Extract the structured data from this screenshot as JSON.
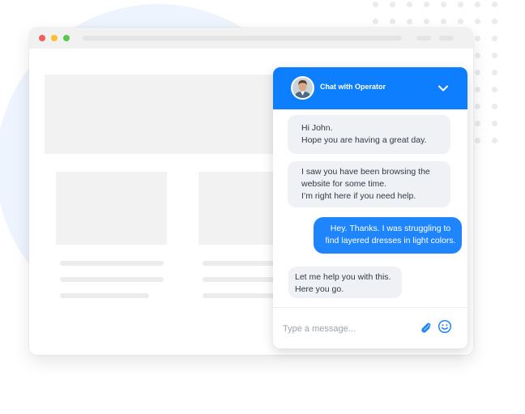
{
  "colors": {
    "accent": "#0d7ffe",
    "bubble_out": "#1f85fd",
    "bubble_in": "#eff1f4",
    "traffic_red": "#f25f58",
    "traffic_yellow": "#fbbe2e",
    "traffic_green": "#58c84f"
  },
  "chat": {
    "title": "Chat with Operator",
    "messages": [
      {
        "from": "operator",
        "lines": [
          "Hi John.",
          "Hope you are having a great day."
        ]
      },
      {
        "from": "operator",
        "lines": [
          "I saw you have been browsing the",
          "website for some time.",
          "I’m right here if you need help."
        ]
      },
      {
        "from": "user",
        "lines": [
          "Hey. Thanks. I was struggling to",
          "find layered dresses in light colors."
        ]
      },
      {
        "from": "operator",
        "lines": [
          "Let me help you with this.",
          "Here you go."
        ]
      }
    ],
    "input_placeholder": "Type a message...",
    "icons": [
      "avatar",
      "chevron-down-icon",
      "paperclip-icon",
      "smiley-icon"
    ]
  }
}
